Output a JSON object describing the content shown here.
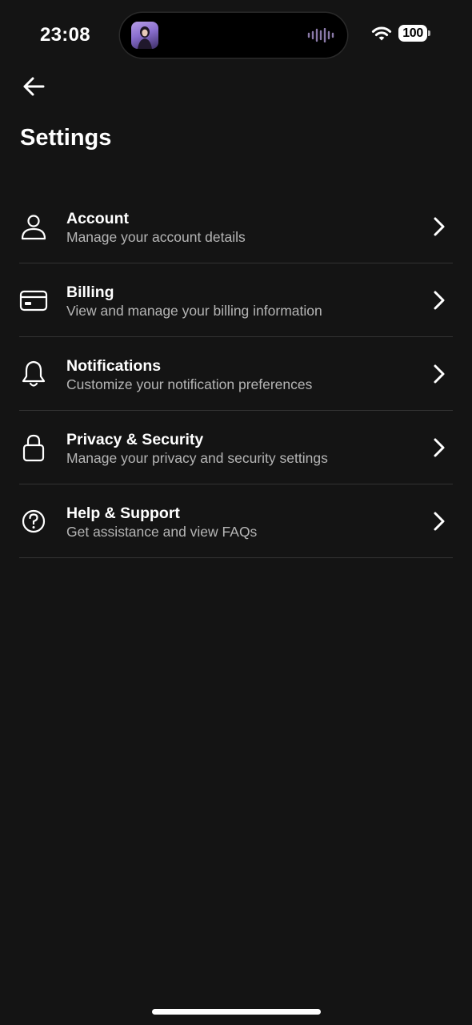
{
  "status_bar": {
    "time": "23:08",
    "battery_level": "100"
  },
  "header": {
    "back_icon": "arrow-left-icon",
    "title": "Settings"
  },
  "settings": {
    "items": [
      {
        "icon": "user-icon",
        "title": "Account",
        "subtitle": "Manage your account details"
      },
      {
        "icon": "credit-card-icon",
        "title": "Billing",
        "subtitle": "View and manage your billing information"
      },
      {
        "icon": "bell-icon",
        "title": "Notifications",
        "subtitle": "Customize your notification preferences"
      },
      {
        "icon": "lock-icon",
        "title": "Privacy & Security",
        "subtitle": "Manage your privacy and security settings"
      },
      {
        "icon": "help-circle-icon",
        "title": "Help & Support",
        "subtitle": "Get assistance and view FAQs"
      }
    ]
  },
  "colors": {
    "background": "#141414",
    "divider": "#333333",
    "text_primary": "#ffffff",
    "text_secondary": "#b5b5b5"
  }
}
